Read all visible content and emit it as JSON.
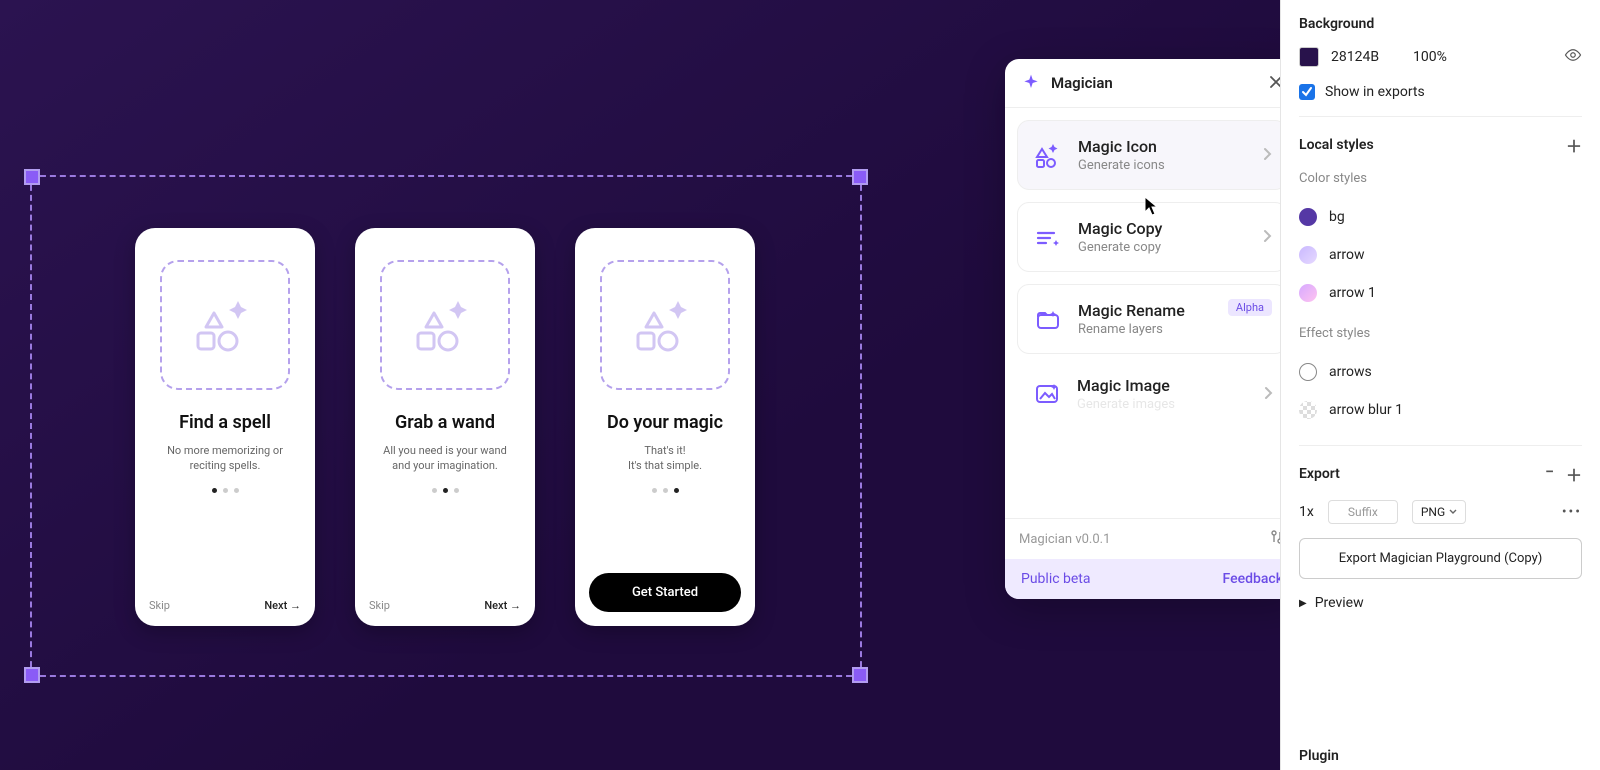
{
  "canvas": {
    "cards": [
      {
        "title": "Find a spell",
        "subtitle": "No more memorizing or reciting spells.",
        "skip": "Skip",
        "next": "Next →",
        "active_dot": 0,
        "cta": null
      },
      {
        "title": "Grab a wand",
        "subtitle": "All you need is your wand and your imagination.",
        "skip": "Skip",
        "next": "Next →",
        "active_dot": 1,
        "cta": null
      },
      {
        "title": "Do your magic",
        "subtitle": "That's it!\nIt's that simple.",
        "skip": null,
        "next": null,
        "active_dot": 2,
        "cta": "Get Started"
      }
    ]
  },
  "plugin": {
    "title": "Magician",
    "features": [
      {
        "title": "Magic Icon",
        "subtitle": "Generate icons",
        "badge": null,
        "icon": "shapes"
      },
      {
        "title": "Magic Copy",
        "subtitle": "Generate copy",
        "badge": null,
        "icon": "lines"
      },
      {
        "title": "Magic Rename",
        "subtitle": "Rename layers",
        "badge": "Alpha",
        "icon": "folder"
      },
      {
        "title": "Magic Image",
        "subtitle": "Generate images",
        "badge": null,
        "icon": "image"
      }
    ],
    "version": "Magician v0.0.1",
    "public_beta": "Public beta",
    "feedback": "Feedback"
  },
  "inspector": {
    "background": {
      "label": "Background",
      "hex": "28124B",
      "opacity": "100%",
      "show_exports": "Show in exports"
    },
    "local_styles": {
      "label": "Local styles",
      "color_label": "Color styles",
      "effect_label": "Effect styles",
      "colors": [
        {
          "name": "bg",
          "swatch": "#5538a5"
        },
        {
          "name": "arrow",
          "swatch": "linear-gradient(135deg,#c9b8ff,#e6d9ff)"
        },
        {
          "name": "arrow 1",
          "swatch": "linear-gradient(135deg,#d6a9ff,#ffc3f0)"
        }
      ],
      "effects": [
        {
          "name": "arrows"
        },
        {
          "name": "arrow blur 1"
        }
      ]
    },
    "export": {
      "label": "Export",
      "scale": "1x",
      "suffix": "Suffix",
      "format": "PNG",
      "button": "Export Magician Playground (Copy)",
      "preview": "Preview"
    },
    "plugin_label": "Plugin"
  }
}
